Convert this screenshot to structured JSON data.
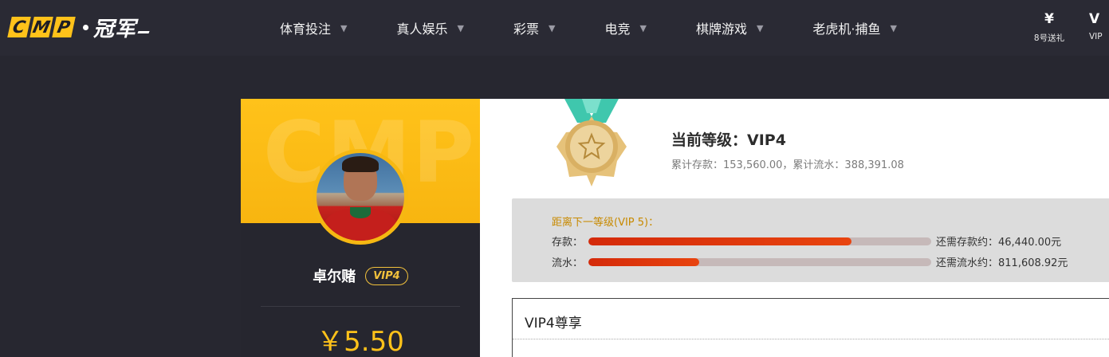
{
  "brand": {
    "letters": [
      "C",
      "M",
      "P"
    ],
    "name": "冠军"
  },
  "nav": [
    {
      "label": "体育投注"
    },
    {
      "label": "真人娱乐"
    },
    {
      "label": "彩票"
    },
    {
      "label": "电竞"
    },
    {
      "label": "棋牌游戏"
    },
    {
      "label": "老虎机·捕鱼"
    }
  ],
  "promos": [
    {
      "icon": "¥",
      "label": "8号送礼"
    },
    {
      "icon": "V",
      "label": "VIP"
    }
  ],
  "profile": {
    "watermark": "CMP",
    "username": "卓尔赌",
    "vip_badge": "VIP4",
    "balance": "￥5.50"
  },
  "level": {
    "title": "当前等级：VIP4",
    "stats": "累计存款：153,560.00，累计流水：388,391.08"
  },
  "progress": {
    "next_title": "距离下一等级(VIP 5)：",
    "rows": [
      {
        "label": "存款：",
        "fraction": 0.768,
        "need": "还需存款约：46,440.00元"
      },
      {
        "label": "流水：",
        "fraction": 0.324,
        "need": "还需流水约：811,608.92元"
      }
    ]
  },
  "privileges": {
    "title": "VIP4尊享"
  },
  "colors": {
    "accent": "#ffc21a",
    "header": "#2a2a34",
    "bar": "#e0380c"
  }
}
